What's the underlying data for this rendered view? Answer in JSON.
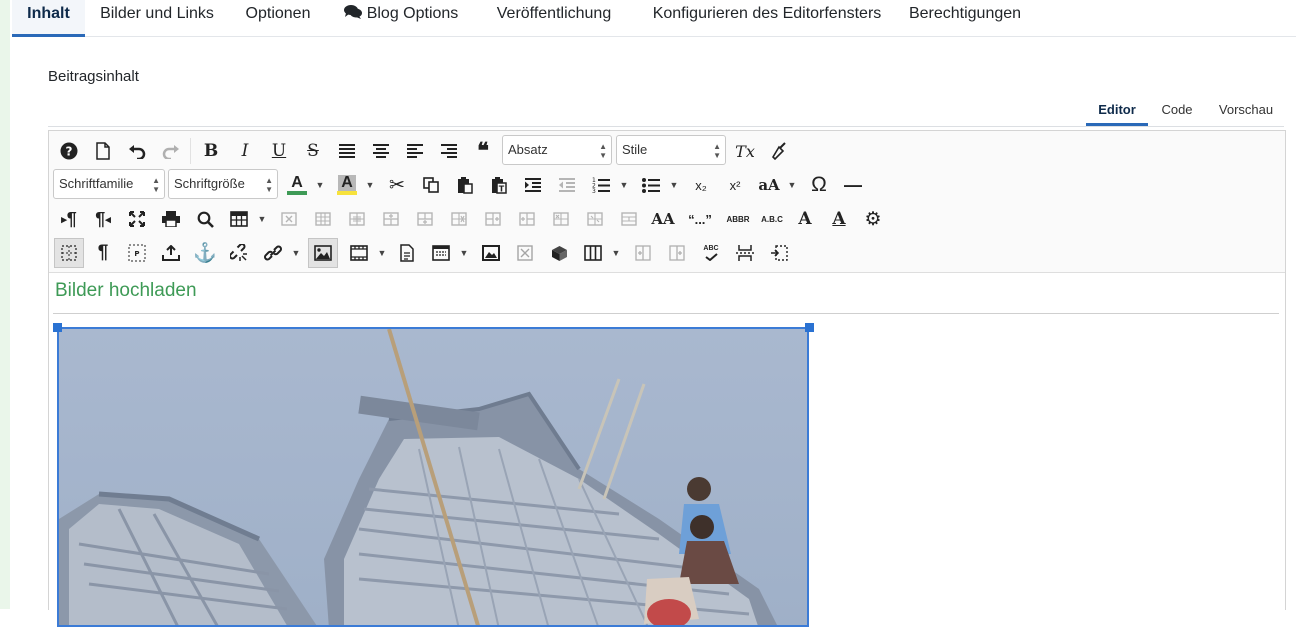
{
  "tabs": [
    {
      "label": "Inhalt",
      "active": true
    },
    {
      "label": "Bilder und Links"
    },
    {
      "label": "Optionen"
    },
    {
      "label": "Blog Options",
      "icon": "comments-icon"
    },
    {
      "label": "Veröffentlichung"
    },
    {
      "label": "Konfigurieren des Editorfensters"
    },
    {
      "label": "Berechtigungen"
    }
  ],
  "section_label": "Beitragsinhalt",
  "editor_tabs": [
    {
      "label": "Editor",
      "active": true
    },
    {
      "label": "Code"
    },
    {
      "label": "Vorschau"
    }
  ],
  "toolbar": {
    "block_format": "Absatz",
    "style_format": "Stile",
    "font_family": "Schriftfamilie",
    "font_size": "Schriftgröße",
    "text_color": "#3e9a56",
    "highlight_color": "#f7e23c",
    "glyphs": {
      "help": "?",
      "undo": "↶",
      "redo": "↷",
      "bold": "B",
      "italic": "I",
      "underline": "U",
      "strike": "S",
      "quote": "❝",
      "clear": "Tx",
      "text_color_letter": "A",
      "bg_color_letter": "A",
      "cut": "✂",
      "subscript": "x₂",
      "superscript": "x²",
      "case": "aA",
      "omega": "Ω",
      "hr": "—",
      "ltr": "¶",
      "rtl": "¶",
      "print": "⎙",
      "search": "⌕",
      "case2": "AA",
      "quotes": "“...”",
      "abbr": "ABBR",
      "acronym": "A.B.C",
      "font_a": "A",
      "font_a2": "A",
      "gear": "⚙",
      "pilcrow": "¶",
      "anchor": "⚓",
      "link": "🔗",
      "spell": "ABC"
    }
  },
  "content": {
    "heading": "Bilder hochladen",
    "image_description": "boats"
  },
  "colors": {
    "accent": "#2a69b8",
    "heading_green": "#3e9a56",
    "selection": "#3b7bd6"
  }
}
